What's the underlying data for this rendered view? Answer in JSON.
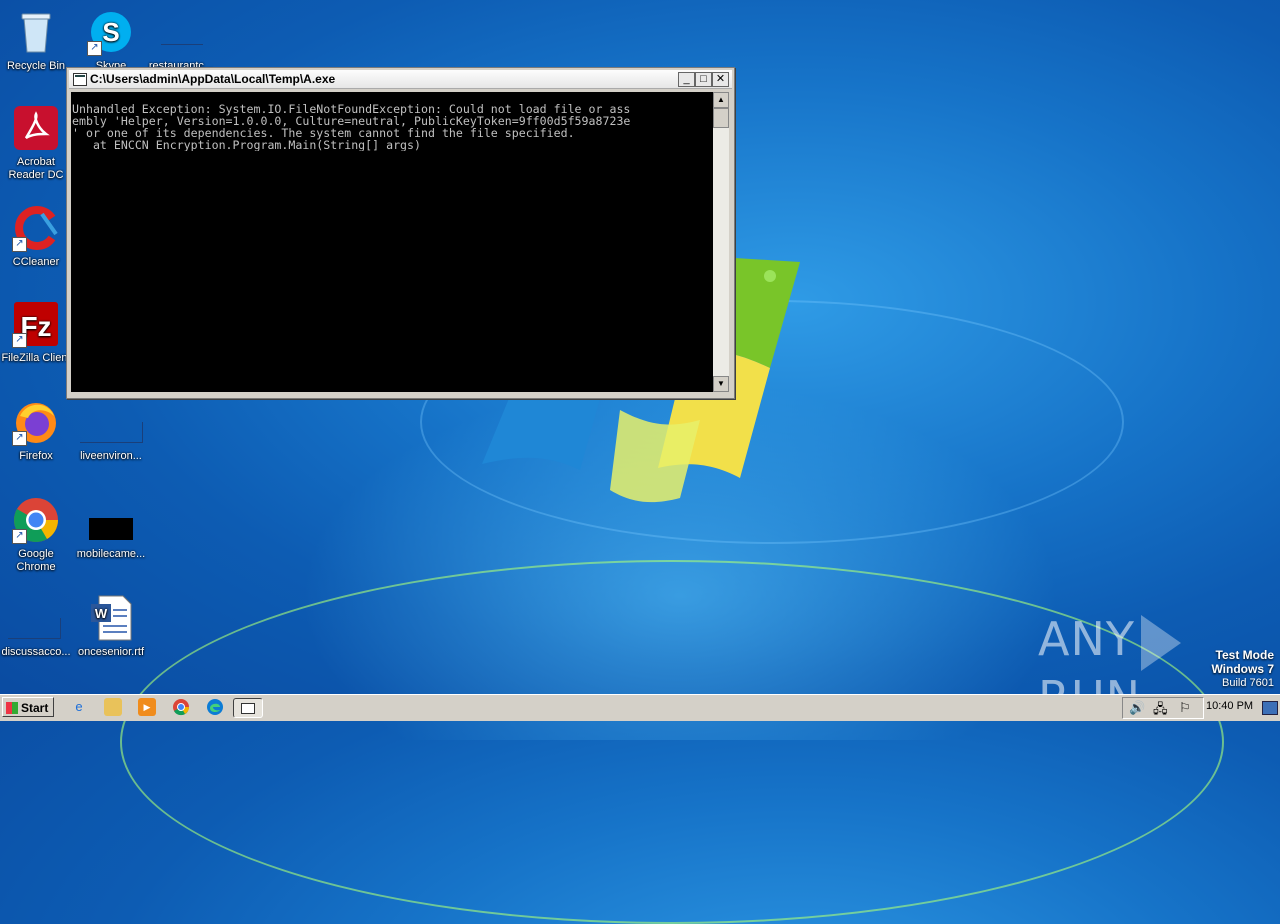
{
  "desktop": {
    "icons": [
      {
        "label": "Recycle Bin",
        "icon": "recycle-bin-icon"
      },
      {
        "label": "Skype",
        "icon": "skype-icon"
      },
      {
        "label": "restaurantc...",
        "icon": "blank-file-icon"
      },
      {
        "label": "Acrobat Reader DC",
        "label_line1": "Acrobat",
        "label_line2": "Reader DC",
        "icon": "acrobat-icon"
      },
      {
        "label": "CCleaner",
        "icon": "ccleaner-icon"
      },
      {
        "label": "FileZilla Client",
        "icon": "filezilla-icon"
      },
      {
        "label": "Firefox",
        "icon": "firefox-icon"
      },
      {
        "label": "liveenviron...",
        "icon": "blank-file-icon"
      },
      {
        "label": "Google Chrome",
        "label_line1": "Google",
        "label_line2": "Chrome",
        "icon": "chrome-icon"
      },
      {
        "label": "mobilecame...",
        "icon": "image-file-icon"
      },
      {
        "label": "discussacco...",
        "icon": "blank-file-icon"
      },
      {
        "label": "oncesenior.rtf",
        "icon": "word-document-icon"
      }
    ]
  },
  "console": {
    "title": "C:\\Users\\admin\\AppData\\Local\\Temp\\A.exe",
    "minimize": "_",
    "maximize": "□",
    "close": "✕",
    "output": "Unhandled Exception: System.IO.FileNotFoundException: Could not load file or ass\nembly 'Helper, Version=1.0.0.0, Culture=neutral, PublicKeyToken=9ff00d5f59a8723e\n' or one of its dependencies. The system cannot find the file specified.\n   at ENCCN_Encryption.Program.Main(String[] args)",
    "scroll_up": "▲",
    "scroll_down": "▼"
  },
  "watermark": {
    "left": "ANY",
    "right": "RUN"
  },
  "test_mode": {
    "line1": "Test Mode",
    "line2": "Windows 7",
    "line3": "Build 7601"
  },
  "taskbar": {
    "start_label": "Start",
    "quick_launch": [
      "ie-icon",
      "explorer-icon",
      "media-player-icon",
      "chrome-icon",
      "edge-icon",
      "console-window-icon"
    ],
    "clock": "10:40 PM"
  }
}
